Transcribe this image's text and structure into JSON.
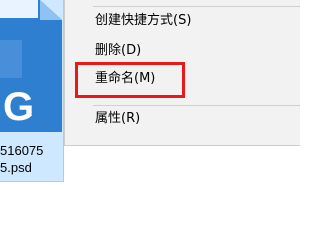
{
  "file": {
    "icon": "psd-file-icon",
    "icon_letter": "G",
    "name_line1": "516075",
    "name_line2": "5.psd",
    "selection_color": "#cde8ff",
    "icon_color": "#2f7fd1"
  },
  "context_menu": {
    "items": [
      {
        "label": "创建快捷方式(S)"
      },
      {
        "label": "删除(D)"
      },
      {
        "label": "重命名(M)",
        "highlighted": true
      },
      {
        "label": "属性(R)"
      }
    ],
    "highlight_color": "#e31b1b"
  }
}
